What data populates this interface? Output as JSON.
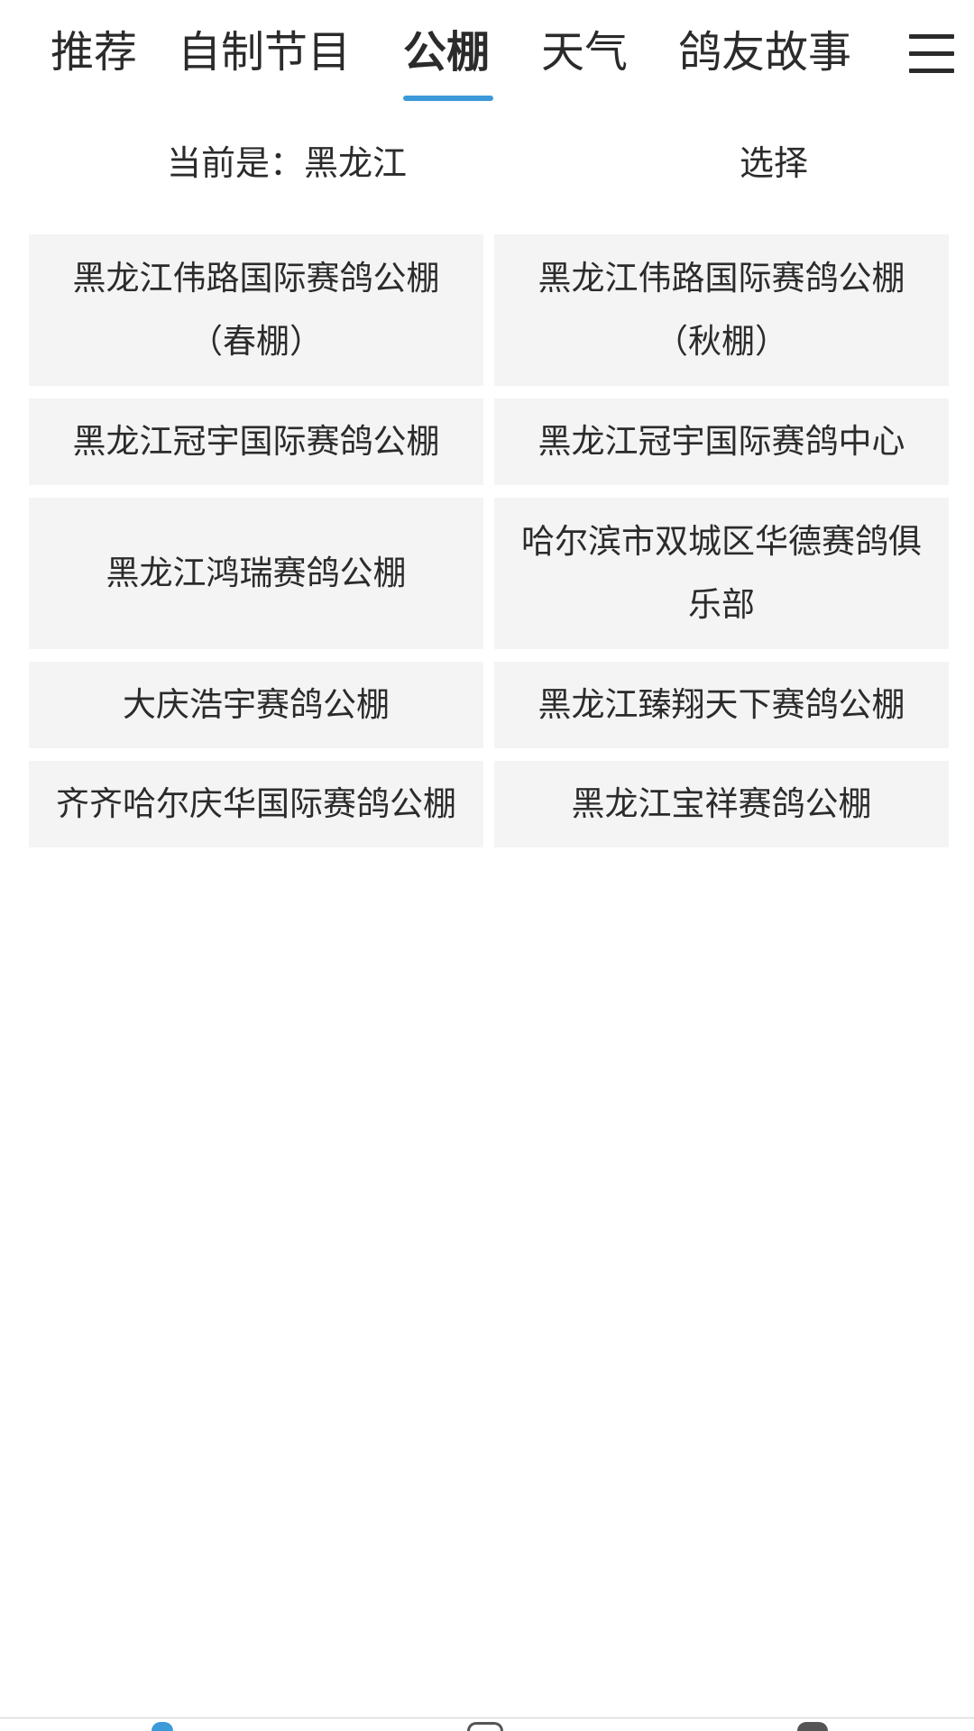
{
  "tabs": [
    {
      "label": "推荐",
      "active": false
    },
    {
      "label": "自制节目",
      "active": false
    },
    {
      "label": "公棚",
      "active": true
    },
    {
      "label": "天气",
      "active": false
    },
    {
      "label": "鸽友故事",
      "active": false
    }
  ],
  "menu_icon": "hamburger-menu-icon",
  "accent_color": "#3c9ad8",
  "region": {
    "current_label": "当前是：黑龙江",
    "select_label": "选择"
  },
  "lofts": [
    "黑龙江伟路国际赛鸽公棚（春棚）",
    "黑龙江伟路国际赛鸽公棚（秋棚）",
    "黑龙江冠宇国际赛鸽公棚",
    "黑龙江冠宇国际赛鸽中心",
    "黑龙江鸿瑞赛鸽公棚",
    "哈尔滨市双城区华德赛鸽俱乐部",
    "大庆浩宇赛鸽公棚",
    "黑龙江臻翔天下赛鸽公棚",
    "齐齐哈尔庆华国际赛鸽公棚",
    "黑龙江宝祥赛鸽公棚"
  ]
}
